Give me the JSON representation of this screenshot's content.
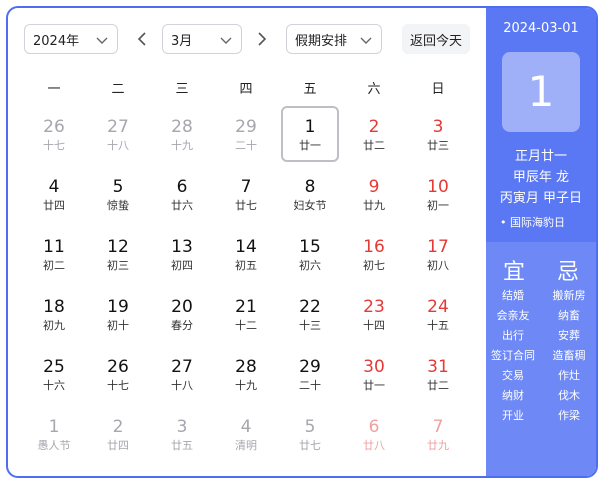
{
  "toolbar": {
    "year": "2024年",
    "month": "3月",
    "holiday": "假期安排",
    "today": "返回今天"
  },
  "weekdays": [
    "一",
    "二",
    "三",
    "四",
    "五",
    "六",
    "日"
  ],
  "days": [
    {
      "num": "26",
      "lunar": "十七",
      "other": true
    },
    {
      "num": "27",
      "lunar": "十八",
      "other": true
    },
    {
      "num": "28",
      "lunar": "十九",
      "other": true
    },
    {
      "num": "29",
      "lunar": "二十",
      "other": true
    },
    {
      "num": "1",
      "lunar": "廿一",
      "selected": true
    },
    {
      "num": "2",
      "lunar": "廿二",
      "weekend": true
    },
    {
      "num": "3",
      "lunar": "廿三",
      "weekend": true
    },
    {
      "num": "4",
      "lunar": "廿四"
    },
    {
      "num": "5",
      "lunar": "惊蛰"
    },
    {
      "num": "6",
      "lunar": "廿六"
    },
    {
      "num": "7",
      "lunar": "廿七"
    },
    {
      "num": "8",
      "lunar": "妇女节"
    },
    {
      "num": "9",
      "lunar": "廿九",
      "weekend": true
    },
    {
      "num": "10",
      "lunar": "初一",
      "weekend": true
    },
    {
      "num": "11",
      "lunar": "初二"
    },
    {
      "num": "12",
      "lunar": "初三"
    },
    {
      "num": "13",
      "lunar": "初四"
    },
    {
      "num": "14",
      "lunar": "初五"
    },
    {
      "num": "15",
      "lunar": "初六"
    },
    {
      "num": "16",
      "lunar": "初七",
      "weekend": true
    },
    {
      "num": "17",
      "lunar": "初八",
      "weekend": true
    },
    {
      "num": "18",
      "lunar": "初九"
    },
    {
      "num": "19",
      "lunar": "初十"
    },
    {
      "num": "20",
      "lunar": "春分"
    },
    {
      "num": "21",
      "lunar": "十二"
    },
    {
      "num": "22",
      "lunar": "十三"
    },
    {
      "num": "23",
      "lunar": "十四",
      "weekend": true
    },
    {
      "num": "24",
      "lunar": "十五",
      "weekend": true
    },
    {
      "num": "25",
      "lunar": "十六"
    },
    {
      "num": "26",
      "lunar": "十七"
    },
    {
      "num": "27",
      "lunar": "十八"
    },
    {
      "num": "28",
      "lunar": "十九"
    },
    {
      "num": "29",
      "lunar": "二十"
    },
    {
      "num": "30",
      "lunar": "廿一",
      "weekend": true
    },
    {
      "num": "31",
      "lunar": "廿二",
      "weekend": true
    },
    {
      "num": "1",
      "lunar": "愚人节",
      "other": true
    },
    {
      "num": "2",
      "lunar": "廿四",
      "other": true
    },
    {
      "num": "3",
      "lunar": "廿五",
      "other": true
    },
    {
      "num": "4",
      "lunar": "清明",
      "other": true
    },
    {
      "num": "5",
      "lunar": "廿七",
      "other": true
    },
    {
      "num": "6",
      "lunar": "廿八",
      "other": true,
      "weekend": true
    },
    {
      "num": "7",
      "lunar": "廿九",
      "other": true,
      "weekend": true
    }
  ],
  "panel": {
    "date": "2024-03-01",
    "day": "1",
    "lunar_date": "正月廿一",
    "year_gz": "甲辰年 龙",
    "month_day_gz": "丙寅月 甲子日",
    "festival": "• 国际海豹日",
    "yi_label": "宜",
    "ji_label": "忌",
    "yi": [
      "结婚",
      "会亲友",
      "出行",
      "签订合同",
      "交易",
      "纳财",
      "开业"
    ],
    "ji": [
      "搬新房",
      "纳畜",
      "安葬",
      "造畜稠",
      "作灶",
      "伐木",
      "作梁"
    ]
  },
  "colors": {
    "accent": "#4e6ef2",
    "panel_top": "#5b78f4",
    "panel_bottom": "#6e89f6",
    "weekend": "#e53935"
  },
  "icons": {
    "dropdown": "chevron-down-icon",
    "prev": "chevron-left-icon",
    "next": "chevron-right-icon"
  }
}
